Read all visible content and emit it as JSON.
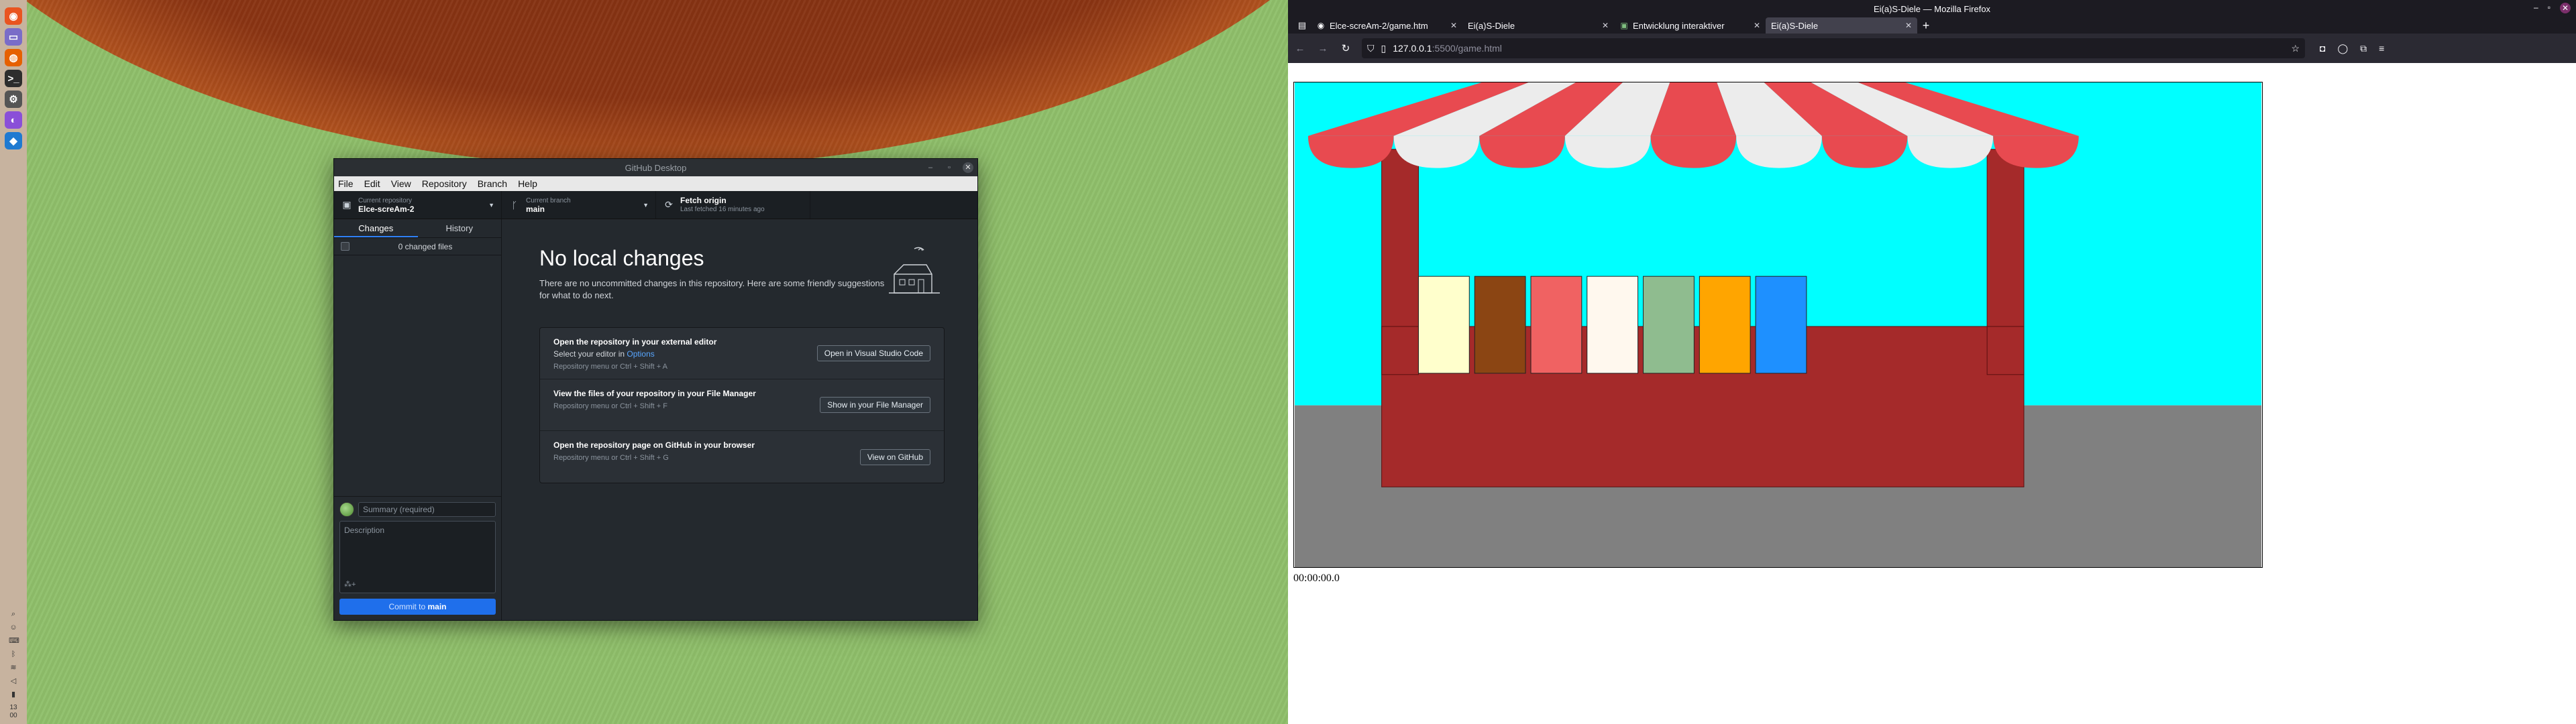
{
  "dock": {
    "icons": [
      {
        "name": "ubuntu-icon",
        "glyph": "◉",
        "color": "#e95420"
      },
      {
        "name": "files-icon",
        "glyph": "▭",
        "color": "#7a6cc8"
      },
      {
        "name": "firefox-icon",
        "glyph": "◍",
        "color": "#e66000"
      },
      {
        "name": "terminal-icon",
        "glyph": ">_",
        "color": "#2d2d2d"
      },
      {
        "name": "settings-icon",
        "glyph": "⚙",
        "color": "#555555"
      },
      {
        "name": "github-desktop-icon",
        "glyph": "◐",
        "color": "#8a4fd8"
      },
      {
        "name": "vscode-icon",
        "glyph": "◆",
        "color": "#1f7ad1"
      }
    ],
    "clock_hour": "13",
    "clock_minute": "00"
  },
  "ghd": {
    "title": "GitHub Desktop",
    "menu": [
      "File",
      "Edit",
      "View",
      "Repository",
      "Branch",
      "Help"
    ],
    "toolbar": {
      "repo_label": "Current repository",
      "repo_value": "Elce-screAm-2",
      "branch_label": "Current branch",
      "branch_value": "main",
      "fetch_title": "Fetch origin",
      "fetch_sub": "Last fetched 16 minutes ago"
    },
    "tabs": {
      "changes": "Changes",
      "history": "History"
    },
    "changed_files": "0 changed files",
    "summary_placeholder": "Summary (required)",
    "description_placeholder": "Description",
    "commit_prefix": "Commit to ",
    "commit_branch": "main",
    "main": {
      "heading": "No local changes",
      "lead": "There are no uncommitted changes in this repository. Here are some friendly suggestions for what to do next.",
      "cards": [
        {
          "title": "Open the repository in your external editor",
          "sub_prefix": "Select your editor in ",
          "sub_link": "Options",
          "hint": "Repository menu or  Ctrl + Shift + A",
          "button": "Open in Visual Studio Code"
        },
        {
          "title": "View the files of your repository in your File Manager",
          "hint": "Repository menu or  Ctrl + Shift + F",
          "button": "Show in your File Manager"
        },
        {
          "title": "Open the repository page on GitHub in your browser",
          "hint": "Repository menu or  Ctrl + Shift + G",
          "button": "View on GitHub"
        }
      ]
    }
  },
  "firefox": {
    "title": "Ei(a)S-Diele — Mozilla Firefox",
    "tabs": [
      {
        "label": "Elce-screAm-2/game.htm",
        "favicon": "github-icon"
      },
      {
        "label": "Ei(a)S-Diele",
        "favicon": "none"
      },
      {
        "label": "Entwicklung interaktiver",
        "favicon": "page-icon"
      },
      {
        "label": "Ei(a)S-Diele",
        "favicon": "none",
        "active": true
      }
    ],
    "url_host": "127.0.0.1",
    "url_path": ":5500/game.html"
  },
  "game": {
    "timer": "00:00:00.0",
    "colors": {
      "sky": "#00ffff",
      "ground": "#808080",
      "stand": "#a52a2a",
      "awning_red": "#e84a50",
      "awning_white": "#ececec"
    },
    "tubs": [
      "#ffffcc",
      "#8b4513",
      "#f06262",
      "#fff8ee",
      "#8fbc8f",
      "#ffa500",
      "#1e90ff"
    ]
  }
}
